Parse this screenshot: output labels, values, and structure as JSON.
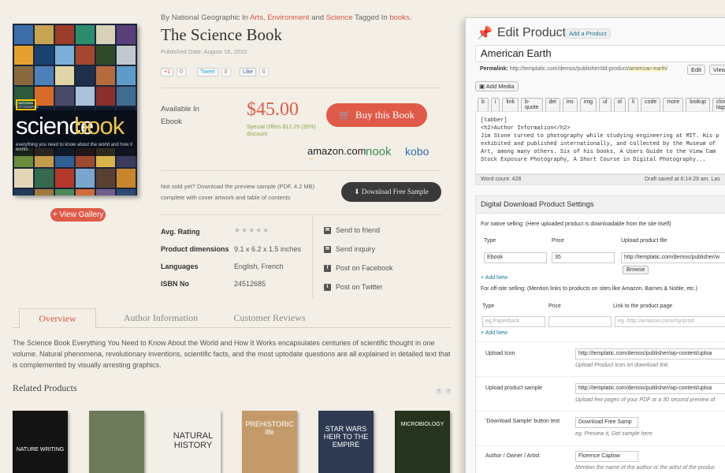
{
  "product": {
    "byline_prefix": "By National Geographic In",
    "cat1": "Arts",
    "cat2": "Environment",
    "and": "and",
    "cat3": "Science",
    "tagged": "Tagged In",
    "tag": "books",
    "title": "The Science Book",
    "published": "Published Date: August 16, 2010",
    "cover_word1": "science",
    "cover_word2": "book",
    "cover_tagline": "everything you need to know about the world and how it works",
    "cover_ng": "NATIONAL GEOGRAPHIC",
    "view_gallery": "+ View Gallery",
    "social": {
      "gplus": "+1",
      "gplus_count": "0",
      "tweet": "Tweet",
      "tweet_count": "0",
      "like": "Like",
      "like_count": "0"
    },
    "available": "Available In",
    "format": "Ebook",
    "price": "$45.00",
    "offer": "Special Offers $12.25 (35%) discount",
    "buy": "Buy this Book",
    "stores": [
      "amazon.com",
      "nook",
      "kobo"
    ],
    "sample_text": "Not sold yet? Download the preview sample (PDF, 4.2 MB) complete with cover artwork and table of contents",
    "download": "Download Free Sample",
    "attributes": [
      {
        "label": "Avg. Rating",
        "value": "★★★★★"
      },
      {
        "label": "Product dimensions",
        "value": "9.1 x 6.2 x 1.5 inches"
      },
      {
        "label": "Languages",
        "value": "English, French"
      },
      {
        "label": "ISBN No",
        "value": "24512685"
      }
    ],
    "rating": 0,
    "actions": [
      "Send to friend",
      "Send inquiry",
      "Post on Facebook",
      "Post on Twitter"
    ],
    "tabs": [
      "Overview",
      "Author Information",
      "Customer Reviews"
    ],
    "description": "The Science Book Everything You Need to Know About the World and How It Works encapsulates centuries of scientific thought in one volume. Natural phenomena, revolutionary inventions, scientific facts, and the most uptodate questions are all explained in detailed text that is complemented by visually arresting graphics.",
    "related_title": "Related Products",
    "related": [
      {
        "title": "NATURE WRITING",
        "color": "#141414"
      },
      {
        "title": "",
        "color": "#6f7a5a"
      },
      {
        "title": "NATURAL HISTORY",
        "color": "#f1efe8"
      },
      {
        "title": "PREHISTORIC life",
        "color": "#c49a6a"
      },
      {
        "title": "STAR WARS HEIR TO THE EMPIRE",
        "color": "#2d3a52"
      },
      {
        "title": "MICROBIOLOGY",
        "color": "#26331e"
      }
    ]
  },
  "wp": {
    "heading": "Edit Product",
    "add_new": "Add a Product",
    "post_title": "American Earth",
    "permalink_label": "Permalink:",
    "permalink_url": "http://templatic.com/demos/publisher/dd-product/",
    "permalink_slug": "american-earth",
    "edit": "Edit",
    "view": "View",
    "add_media": "Add Media",
    "quicktags": [
      "b",
      "i",
      "link",
      "b-quote",
      "del",
      "ins",
      "img",
      "ul",
      "ol",
      "li",
      "code",
      "more",
      "lookup",
      "close tags"
    ],
    "editor_lines": [
      "[tabber]",
      "<h2>Author Information</h2>",
      "Jim Stone turned to photography while studying engineering at MIT. His p",
      "exhibited and published internationally, and collected by the Museum of",
      "Art, among many others. Six of his books, A Users Guide to the View Cam",
      "Stock Exposure Photography, A Short Course in Digital Photography..."
    ],
    "word_count": "Word count: 428",
    "draft_saved": "Draft saved at 6:14:29 am. Las",
    "meta_title": "Digital Download Product Settings",
    "native_label": "For native selling: (Here uploaded product is downloadable from the site itself)",
    "col_type": "Type",
    "col_price": "Price",
    "col_file": "Upload product file",
    "row_type": "Ebook",
    "row_price": "35",
    "row_file": "http://templatic.com/demos/publisher/w",
    "browse": "Browse",
    "add_new_link": "+ Add New",
    "offsite_label": "For off-site selling: (Mention links to products on sites like Amazon, Barnes & Noble, etc.)",
    "col_link": "Link to the product page",
    "ph_type": "eg.Paperback",
    "ph_link": "eg. http://amazon.com/my/prod",
    "upload_icon_label": "Upload Icon",
    "upload_icon_val": "http://templatic.com/demos/publisher/wp-content/uploa",
    "upload_icon_hint": "Upload Product Icon on download link.",
    "upload_sample_label": "Upload product sample",
    "upload_sample_val": "http://templatic.com/demos/publisher/wp-content/uploa",
    "upload_sample_hint": "Upload few pages of your PDF or a 30 second preview of",
    "dl_btn_label": "'Download Sample' button text",
    "dl_btn_val": "Download Free Samp",
    "dl_btn_hint": "eg. Preview it, Get sample here.",
    "author_label": "Author / Owner / Artist",
    "author_val": "Florence Caplow",
    "author_hint": "Mention the name of the author or the artist of the produc"
  },
  "colors": {
    "accent": "#e05a48",
    "link": "#21759b",
    "page_bg": "#f3efe6"
  }
}
